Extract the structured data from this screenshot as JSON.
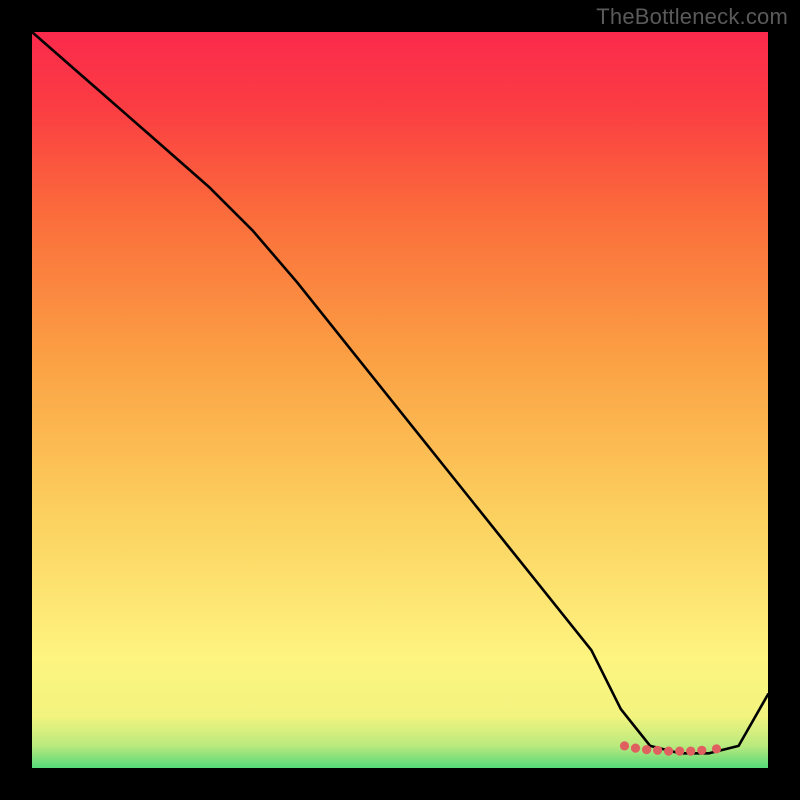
{
  "watermark": "TheBottleneck.com",
  "chart_data": {
    "type": "line",
    "title": "",
    "xlabel": "",
    "ylabel": "",
    "xlim": [
      0,
      100
    ],
    "ylim": [
      0,
      100
    ],
    "series": [
      {
        "name": "bottleneck-curve",
        "x": [
          0,
          8,
          16,
          24,
          30,
          36,
          44,
          52,
          60,
          68,
          76,
          80,
          84,
          88,
          92,
          96,
          100
        ],
        "y": [
          100,
          93,
          86,
          79,
          73,
          66,
          56,
          46,
          36,
          26,
          16,
          8,
          3,
          2,
          2,
          3,
          10
        ]
      }
    ],
    "markers": {
      "name": "optimal-range-dots",
      "x": [
        80.5,
        82,
        83.5,
        85,
        86.5,
        88,
        89.5,
        91,
        93
      ],
      "y": [
        3.0,
        2.7,
        2.5,
        2.4,
        2.3,
        2.3,
        2.3,
        2.4,
        2.6
      ]
    },
    "gradient_stops": [
      {
        "offset": 0,
        "color": "#56d97a"
      },
      {
        "offset": 3,
        "color": "#b9e97e"
      },
      {
        "offset": 7,
        "color": "#f2f47f"
      },
      {
        "offset": 15,
        "color": "#fef480"
      },
      {
        "offset": 35,
        "color": "#fccf5e"
      },
      {
        "offset": 55,
        "color": "#fba244"
      },
      {
        "offset": 75,
        "color": "#fb6d3b"
      },
      {
        "offset": 90,
        "color": "#fb3c43"
      },
      {
        "offset": 100,
        "color": "#fb2a4c"
      }
    ]
  }
}
